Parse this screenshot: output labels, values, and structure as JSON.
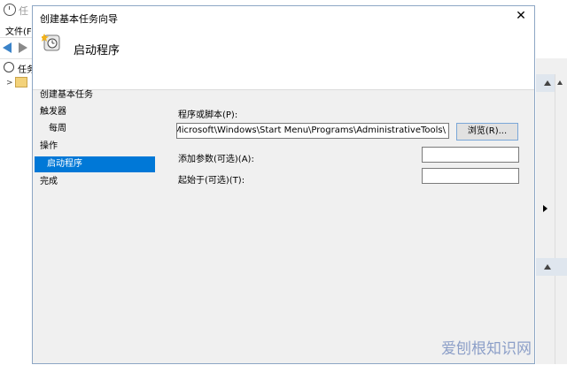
{
  "background_window": {
    "title": "任",
    "menu": "文件(F",
    "tree_label": "任务"
  },
  "dialog": {
    "title": "创建基本任务向导",
    "close_glyph": "✕",
    "header_title": "启动程序",
    "steps": [
      {
        "label": "创建基本任务"
      },
      {
        "label": "触发器"
      },
      {
        "label": "每周"
      },
      {
        "label": "操作"
      },
      {
        "label": "启动程序"
      },
      {
        "label": "完成"
      }
    ],
    "form": {
      "program_label": "程序或脚本(P):",
      "program_value": "\\Microsoft\\Windows\\Start Menu\\Programs\\AdministrativeTools",
      "browse_button": "浏览(R)...",
      "args_label": "添加参数(可选)(A):",
      "args_value": "",
      "start_in_label": "起始于(可选)(T):",
      "start_in_value": ""
    }
  },
  "watermark": "爱刨根知识网"
}
